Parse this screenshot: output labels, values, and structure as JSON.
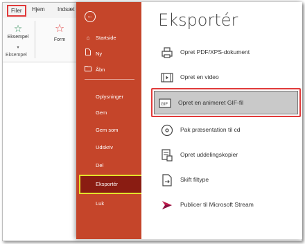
{
  "ribbon": {
    "tabs": [
      "Filer",
      "Hjem",
      "Indsæt"
    ],
    "groups": {
      "eksempel_button": "Eksempel",
      "eksempel_caret": "▾",
      "form_button": "Form",
      "group_label": "Eksempel"
    }
  },
  "backstage": {
    "back_icon": "←",
    "nav_top": [
      {
        "label": "Startside",
        "icon": "home-icon",
        "glyph": "⌂"
      },
      {
        "label": "Ny",
        "icon": "new-doc-icon",
        "glyph": "🗋"
      },
      {
        "label": "Åbn",
        "icon": "open-folder-icon",
        "glyph": "🗁"
      }
    ],
    "nav_bottom": [
      "Oplysninger",
      "Gem",
      "Gem som",
      "Udskriv",
      "Del",
      "Eksportér",
      "Luk"
    ],
    "active": "Eksportér",
    "colors": {
      "nav_bg": "#c5452a",
      "active_bg": "#8a1c12",
      "active_border": "#e3e32b",
      "highlight": "#e03a3a"
    }
  },
  "export": {
    "title": "Eksportér",
    "options": [
      {
        "label": "Opret PDF/XPS-dokument",
        "icon": "pdf-icon"
      },
      {
        "label": "Opret en video",
        "icon": "video-icon"
      },
      {
        "label": "Opret en animeret GIF-fil",
        "icon": "gif-icon",
        "selected": true
      },
      {
        "label": "Pak præsentation til cd",
        "icon": "cd-icon"
      },
      {
        "label": "Opret uddelingskopier",
        "icon": "handouts-icon"
      },
      {
        "label": "Skift filtype",
        "icon": "change-filetype-icon"
      },
      {
        "label": "Publicer til Microsoft Stream",
        "icon": "stream-icon"
      }
    ]
  }
}
